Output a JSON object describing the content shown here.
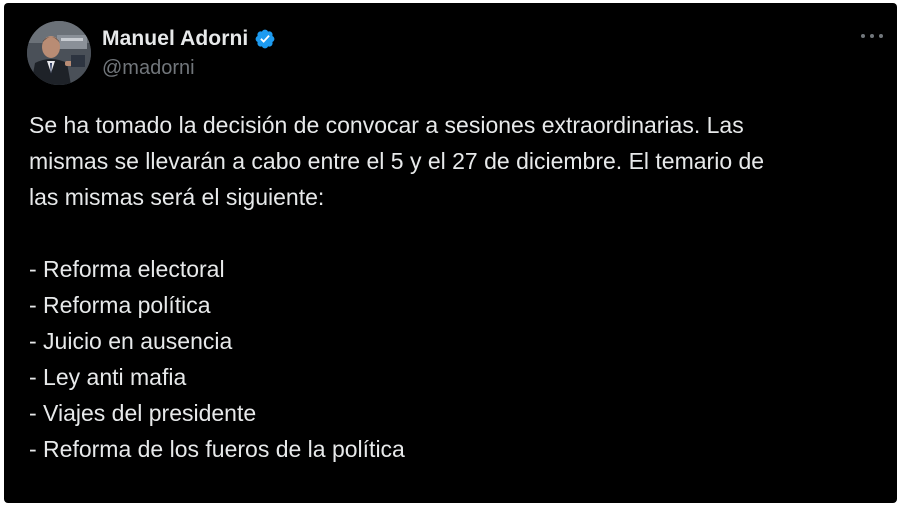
{
  "tweet": {
    "author": {
      "name": "Manuel Adorni",
      "handle": "@madorni",
      "verified": true,
      "verified_color": "#1d9bf0"
    },
    "more_menu_icon": "ellipsis-icon",
    "intro_lines": [
      "Se ha tomado la decisión de convocar a sesiones extraordinarias. Las",
      "mismas se llevarán a cabo entre el 5 y el 27 de diciembre. El temario de",
      "las mismas será el siguiente:"
    ],
    "topics": [
      "- Reforma electoral",
      "- Reforma política",
      "- Juicio en ausencia",
      "- Ley anti mafia",
      "- Viajes del presidente",
      "- Reforma de los fueros de la política"
    ]
  },
  "colors": {
    "background": "#000000",
    "text": "#e7e9ea",
    "muted": "#71767b"
  }
}
